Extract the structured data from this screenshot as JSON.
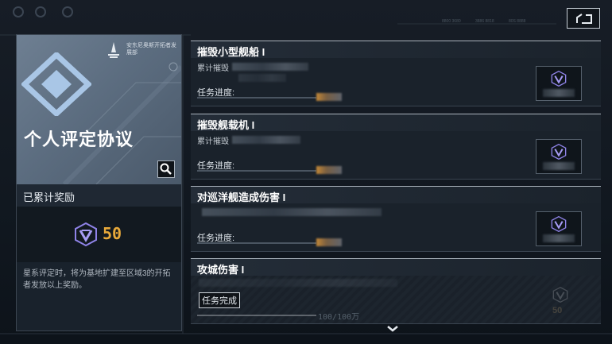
{
  "top_bar": {
    "back_icon": "back-arrow-icon",
    "tiny_labels": [
      "8800 3680",
      "3886 8818",
      "80S 8888"
    ]
  },
  "left_panel": {
    "org_name": "安东尼奥斯开拓者发展部",
    "title": "个人评定协议",
    "search_icon": "magnifier-icon",
    "reward_section_title": "已累计奖励",
    "reward_amount": "50",
    "description": "星系评定时，将为基地扩建至区域3的开拓者发放以上奖励。"
  },
  "missions": [
    {
      "name": "摧毁小型舰船 I",
      "subtitle": "累计摧毁",
      "progress_label": "任务进度:",
      "progress": 0.0,
      "completed": false
    },
    {
      "name": "摧毁舰载机 I",
      "subtitle": "累计摧毁",
      "progress_label": "任务进度:",
      "progress": 0.0,
      "completed": false
    },
    {
      "name": "对巡洋舰造成伤害 I",
      "subtitle": "",
      "progress_label": "任务进度:",
      "progress": 0.0,
      "completed": false
    },
    {
      "name": "攻城伤害 I",
      "subtitle": "",
      "progress_label": "任务完成",
      "progress": 1.0,
      "progress_text": "100/100万",
      "reward_amount": "50",
      "completed": true
    }
  ],
  "colors": {
    "accent_gold": "#e8a93a",
    "emblem_blue": "#a9c6e6",
    "panel_bg": "#1a222b"
  }
}
